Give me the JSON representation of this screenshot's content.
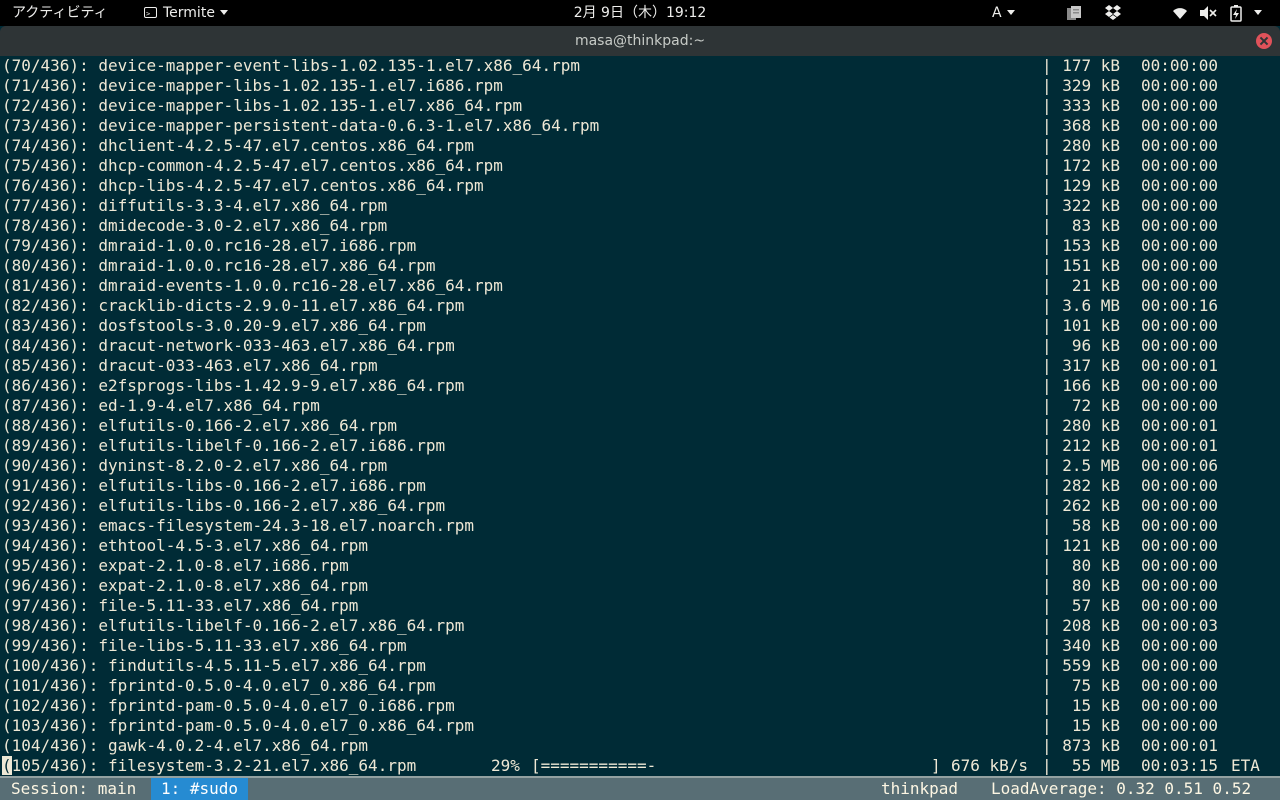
{
  "topbar": {
    "activities": "アクティビティ",
    "app_name": "Termite",
    "clock": "2月 9日（木）19:12",
    "input_method": "A"
  },
  "window": {
    "title": "masa@thinkpad:~"
  },
  "terminal": {
    "rows": [
      {
        "idx": "(70/436): device-mapper-event-libs-1.02.135-1.el7.x86_64.rpm",
        "size": "177 kB",
        "time": "00:00:00"
      },
      {
        "idx": "(71/436): device-mapper-libs-1.02.135-1.el7.i686.rpm",
        "size": "329 kB",
        "time": "00:00:00"
      },
      {
        "idx": "(72/436): device-mapper-libs-1.02.135-1.el7.x86_64.rpm",
        "size": "333 kB",
        "time": "00:00:00"
      },
      {
        "idx": "(73/436): device-mapper-persistent-data-0.6.3-1.el7.x86_64.rpm",
        "size": "368 kB",
        "time": "00:00:00"
      },
      {
        "idx": "(74/436): dhclient-4.2.5-47.el7.centos.x86_64.rpm",
        "size": "280 kB",
        "time": "00:00:00"
      },
      {
        "idx": "(75/436): dhcp-common-4.2.5-47.el7.centos.x86_64.rpm",
        "size": "172 kB",
        "time": "00:00:00"
      },
      {
        "idx": "(76/436): dhcp-libs-4.2.5-47.el7.centos.x86_64.rpm",
        "size": "129 kB",
        "time": "00:00:00"
      },
      {
        "idx": "(77/436): diffutils-3.3-4.el7.x86_64.rpm",
        "size": "322 kB",
        "time": "00:00:00"
      },
      {
        "idx": "(78/436): dmidecode-3.0-2.el7.x86_64.rpm",
        "size": "83 kB",
        "time": "00:00:00"
      },
      {
        "idx": "(79/436): dmraid-1.0.0.rc16-28.el7.i686.rpm",
        "size": "153 kB",
        "time": "00:00:00"
      },
      {
        "idx": "(80/436): dmraid-1.0.0.rc16-28.el7.x86_64.rpm",
        "size": "151 kB",
        "time": "00:00:00"
      },
      {
        "idx": "(81/436): dmraid-events-1.0.0.rc16-28.el7.x86_64.rpm",
        "size": "21 kB",
        "time": "00:00:00"
      },
      {
        "idx": "(82/436): cracklib-dicts-2.9.0-11.el7.x86_64.rpm",
        "size": "3.6 MB",
        "time": "00:00:16"
      },
      {
        "idx": "(83/436): dosfstools-3.0.20-9.el7.x86_64.rpm",
        "size": "101 kB",
        "time": "00:00:00"
      },
      {
        "idx": "(84/436): dracut-network-033-463.el7.x86_64.rpm",
        "size": "96 kB",
        "time": "00:00:00"
      },
      {
        "idx": "(85/436): dracut-033-463.el7.x86_64.rpm",
        "size": "317 kB",
        "time": "00:00:01"
      },
      {
        "idx": "(86/436): e2fsprogs-libs-1.42.9-9.el7.x86_64.rpm",
        "size": "166 kB",
        "time": "00:00:00"
      },
      {
        "idx": "(87/436): ed-1.9-4.el7.x86_64.rpm",
        "size": "72 kB",
        "time": "00:00:00"
      },
      {
        "idx": "(88/436): elfutils-0.166-2.el7.x86_64.rpm",
        "size": "280 kB",
        "time": "00:00:01"
      },
      {
        "idx": "(89/436): elfutils-libelf-0.166-2.el7.i686.rpm",
        "size": "212 kB",
        "time": "00:00:01"
      },
      {
        "idx": "(90/436): dyninst-8.2.0-2.el7.x86_64.rpm",
        "size": "2.5 MB",
        "time": "00:00:06"
      },
      {
        "idx": "(91/436): elfutils-libs-0.166-2.el7.i686.rpm",
        "size": "282 kB",
        "time": "00:00:00"
      },
      {
        "idx": "(92/436): elfutils-libs-0.166-2.el7.x86_64.rpm",
        "size": "262 kB",
        "time": "00:00:00"
      },
      {
        "idx": "(93/436): emacs-filesystem-24.3-18.el7.noarch.rpm",
        "size": "58 kB",
        "time": "00:00:00"
      },
      {
        "idx": "(94/436): ethtool-4.5-3.el7.x86_64.rpm",
        "size": "121 kB",
        "time": "00:00:00"
      },
      {
        "idx": "(95/436): expat-2.1.0-8.el7.i686.rpm",
        "size": "80 kB",
        "time": "00:00:00"
      },
      {
        "idx": "(96/436): expat-2.1.0-8.el7.x86_64.rpm",
        "size": "80 kB",
        "time": "00:00:00"
      },
      {
        "idx": "(97/436): file-5.11-33.el7.x86_64.rpm",
        "size": "57 kB",
        "time": "00:00:00"
      },
      {
        "idx": "(98/436): elfutils-libelf-0.166-2.el7.x86_64.rpm",
        "size": "208 kB",
        "time": "00:00:03"
      },
      {
        "idx": "(99/436): file-libs-5.11-33.el7.x86_64.rpm",
        "size": "340 kB",
        "time": "00:00:00"
      },
      {
        "idx": "(100/436): findutils-4.5.11-5.el7.x86_64.rpm",
        "size": "559 kB",
        "time": "00:00:00"
      },
      {
        "idx": "(101/436): fprintd-0.5.0-4.0.el7_0.x86_64.rpm",
        "size": "75 kB",
        "time": "00:00:00"
      },
      {
        "idx": "(102/436): fprintd-pam-0.5.0-4.0.el7_0.i686.rpm",
        "size": "15 kB",
        "time": "00:00:00"
      },
      {
        "idx": "(103/436): fprintd-pam-0.5.0-4.0.el7_0.x86_64.rpm",
        "size": "15 kB",
        "time": "00:00:00"
      },
      {
        "idx": "(104/436): gawk-4.0.2-4.el7.x86_64.rpm",
        "size": "873 kB",
        "time": "00:00:01"
      }
    ],
    "separator": "|",
    "progress": {
      "cursor_char": "(",
      "label": "105/436): filesystem-3.2-21.el7.x86_64.rpm",
      "percent": "29%",
      "bar": "[===========-",
      "bar_end": "]",
      "rate": "676 kB/s",
      "size": "55 MB",
      "time": "00:03:15",
      "eta": "ETA"
    }
  },
  "statusbar": {
    "session": "Session: main",
    "active_window": "1: #sudo",
    "hostname": "thinkpad",
    "load_average": "LoadAverage: 0.32 0.51 0.52"
  }
}
